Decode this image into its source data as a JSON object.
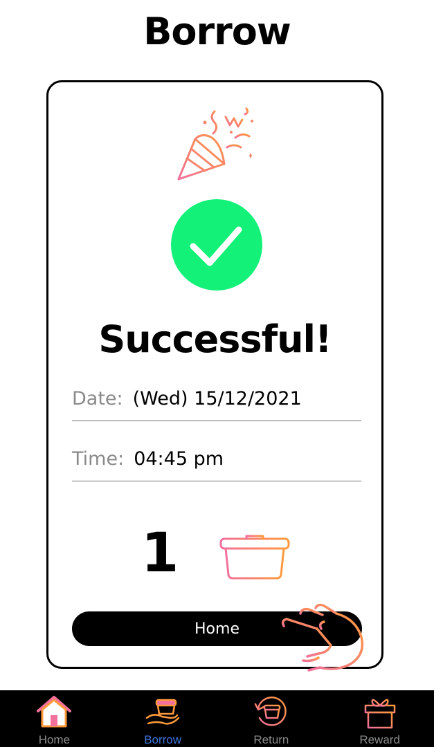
{
  "header": {
    "title": "Borrow"
  },
  "card": {
    "title": "Successful!",
    "date_label": "Date:",
    "date_value": "(Wed) 15/12/2021",
    "time_label": "Time:",
    "time_value": "04:45 pm",
    "count": "1",
    "home_button_label": "Home",
    "party_icon": "party-popper-icon",
    "check_icon": "check-circle-icon",
    "box_icon": "food-container-icon",
    "hand_icon": "pointing-hand-icon",
    "check_color": "#13f178",
    "accent_gradient": [
      "#f2709c",
      "#ff9a3c"
    ]
  },
  "tabbar": {
    "tabs": [
      {
        "label": "Home",
        "icon": "home-icon",
        "active": false
      },
      {
        "label": "Borrow",
        "icon": "borrow-icon",
        "active": true
      },
      {
        "label": "Return",
        "icon": "return-icon",
        "active": false
      },
      {
        "label": "Reward",
        "icon": "gift-icon",
        "active": false
      }
    ],
    "active_color": "#3e74e0",
    "inactive_color": "#8a8a8a"
  }
}
